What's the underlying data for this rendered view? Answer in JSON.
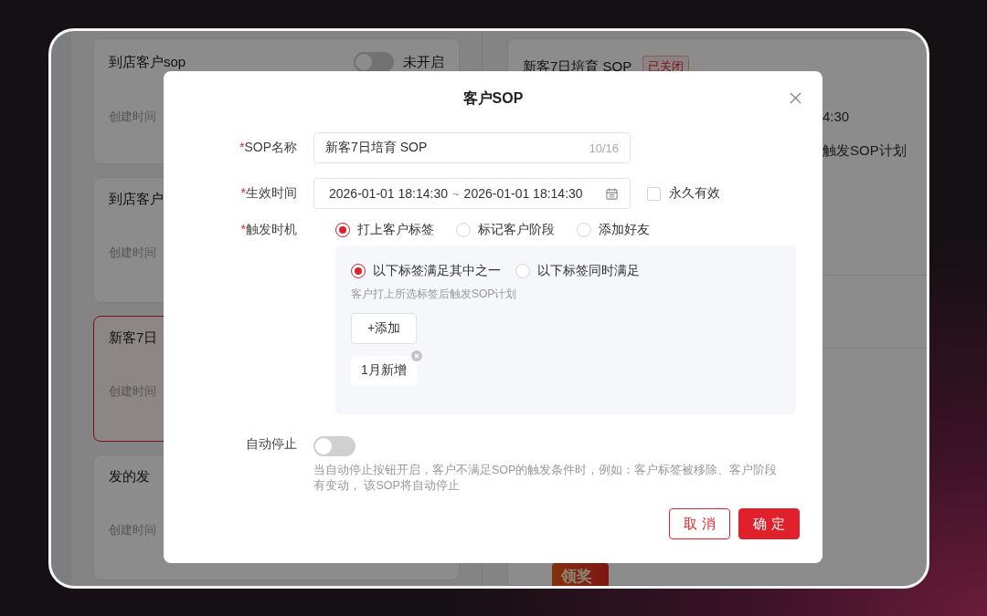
{
  "background_app": {
    "cards": [
      {
        "title": "到店客户sop",
        "toggle": {
          "on": false,
          "label": "未开启"
        },
        "meta_label": "创建时间",
        "selected": false
      },
      {
        "title": "到店客户",
        "meta_label": "创建时间",
        "selected": false
      },
      {
        "title": "新客7日",
        "meta_label": "创建时间",
        "selected": true
      },
      {
        "title": "发的发",
        "meta_label": "创建时间",
        "selected": false
      }
    ],
    "detail_card": {
      "title": "新客7日培育 SOP",
      "status_tag": "已关闭",
      "lines": [
        "4:30",
        "触发SOP计划"
      ],
      "badge": "领奖"
    }
  },
  "dialog": {
    "title": "客户SOP",
    "fields": [
      {
        "kind": "text",
        "required_mark": "*",
        "label": "SOP名称",
        "value": "新客7日培育 SOP",
        "counter": "10/16"
      },
      {
        "kind": "daterange",
        "required_mark": "*",
        "label": "生效时间",
        "start": "2026-01-01 18:14:30",
        "separator": "~",
        "end": "2026-01-01 18:14:30",
        "checkbox": {
          "label": "永久有效",
          "checked": false
        }
      },
      {
        "kind": "radios",
        "required_mark": "*",
        "label": "触发时机",
        "options": [
          {
            "label": "打上客户标签",
            "selected": true
          },
          {
            "label": "标记客户阶段",
            "selected": false
          },
          {
            "label": "添加好友",
            "selected": false
          }
        ],
        "panel": {
          "options": [
            {
              "label": "以下标签满足其中之一",
              "selected": true
            },
            {
              "label": "以下标签同时满足",
              "selected": false
            }
          ],
          "hint": "客户打上所选标签后触发SOP计划",
          "add_button": "+添加",
          "tags": [
            {
              "label": "1月新增"
            }
          ]
        }
      },
      {
        "kind": "toggle",
        "label": "自动停止",
        "on": false,
        "hint": "当自动停止按钮开启，客户不满足SOP的触发条件时，例如：客户标签被移除、客户阶段有变动， 该SOP将自动停止"
      }
    ],
    "buttons": [
      {
        "kind": "secondary",
        "label": "取 消"
      },
      {
        "kind": "primary",
        "label": "确 定"
      }
    ]
  }
}
